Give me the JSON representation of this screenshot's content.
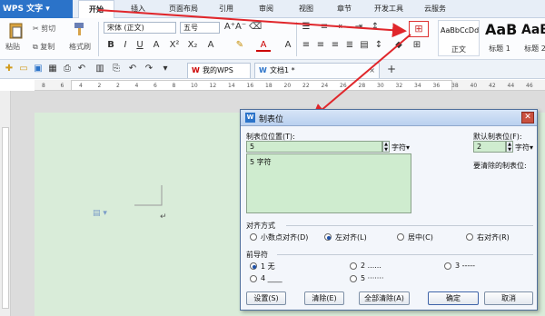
{
  "menubar": {
    "app_name": "WPS 文字",
    "tabs": [
      {
        "label": "开始",
        "active": true
      },
      {
        "label": "插入"
      },
      {
        "label": "页面布局"
      },
      {
        "label": "引用"
      },
      {
        "label": "审阅"
      },
      {
        "label": "视图"
      },
      {
        "label": "章节"
      },
      {
        "label": "开发工具"
      },
      {
        "label": "云服务"
      }
    ]
  },
  "ribbon": {
    "paste": "粘贴",
    "cut": "剪切",
    "copy": "复制",
    "format_painter": "格式刷",
    "font_name": "宋体 (正文)",
    "font_size": "五号",
    "styles": [
      {
        "preview": "AaBbCcDd",
        "label": "正文"
      },
      {
        "preview": "AaBl",
        "label": "标题 1"
      },
      {
        "preview": "AaBb",
        "label": "标题 2"
      }
    ]
  },
  "doc_tabs": {
    "my_wps": "我的WPS",
    "doc1": "文档1 *",
    "add": "+"
  },
  "ruler": {
    "marks": [
      "8",
      "6",
      "4",
      "2",
      "2",
      "4",
      "6",
      "8",
      "10",
      "12",
      "14",
      "16",
      "18",
      "20",
      "22",
      "24",
      "26",
      "28",
      "30",
      "32",
      "34",
      "36",
      "38",
      "40",
      "42",
      "44",
      "46"
    ]
  },
  "dialog": {
    "title": "制表位",
    "tab_position_label": "制表位位置(T):",
    "tab_position_value": "5",
    "tab_position_unit": "字符",
    "tab_list": [
      "5 字符"
    ],
    "default_tab_label": "默认制表位(F):",
    "default_tab_value": "2",
    "default_tab_unit": "字符",
    "clear_label": "要清除的制表位:",
    "alignment_label": "对齐方式",
    "alignment_options": [
      {
        "label": "小数点对齐(D)",
        "selected": false
      },
      {
        "label": "左对齐(L)",
        "selected": true
      },
      {
        "label": "居中(C)",
        "selected": false
      },
      {
        "label": "右对齐(R)",
        "selected": false
      }
    ],
    "leader_label": "前导符",
    "leader_options": [
      {
        "label": "1 无",
        "selected": true
      },
      {
        "label": "2 ......",
        "selected": false
      },
      {
        "label": "3 -----",
        "selected": false
      },
      {
        "label": "4 ____",
        "selected": false
      },
      {
        "label": "5 ·······",
        "selected": false
      }
    ],
    "buttons": {
      "set": "设置(S)",
      "clear": "清除(E)",
      "clear_all": "全部清除(A)",
      "ok": "确定",
      "cancel": "取消"
    }
  },
  "colors": {
    "arrow": "#e0262b",
    "accent": "#2b73c9",
    "page_bg": "#d9ecd9"
  }
}
